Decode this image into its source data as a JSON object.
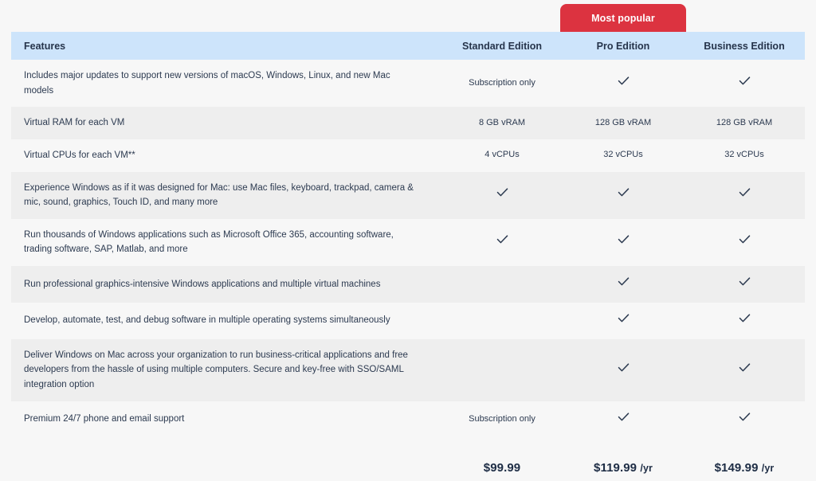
{
  "badge": {
    "label": "Most popular",
    "color": "#dc3340",
    "column": "Pro Edition"
  },
  "header": {
    "feature_column_label": "Features",
    "plans": [
      {
        "name": "Standard Edition"
      },
      {
        "name": "Pro Edition"
      },
      {
        "name": "Business Edition"
      }
    ],
    "background_color": "#cde4fb"
  },
  "rows": [
    {
      "feature": "Includes major updates to support new versions of macOS, Windows, Linux, and new Mac models",
      "standard": "Subscription only",
      "pro": "check",
      "business": "check"
    },
    {
      "feature": "Virtual RAM for each VM",
      "standard": "8 GB vRAM",
      "pro": "128 GB vRAM",
      "business": "128 GB vRAM"
    },
    {
      "feature": "Virtual CPUs for each VM**",
      "standard": "4 vCPUs",
      "pro": "32 vCPUs",
      "business": "32 vCPUs"
    },
    {
      "feature": "Experience Windows as if it was designed for Mac: use Mac files, keyboard, trackpad, camera & mic, sound, graphics, Touch ID, and many more",
      "standard": "check",
      "pro": "check",
      "business": "check"
    },
    {
      "feature": "Run thousands of Windows applications such as Microsoft Office 365, accounting software, trading software, SAP, Matlab, and more",
      "standard": "check",
      "pro": "check",
      "business": "check"
    },
    {
      "feature": "Run professional graphics-intensive Windows applications and multiple virtual machines",
      "standard": "",
      "pro": "check",
      "business": "check"
    },
    {
      "feature": "Develop, automate, test, and debug software in multiple operating systems simultaneously",
      "standard": "",
      "pro": "check",
      "business": "check"
    },
    {
      "feature": "Deliver Windows on Mac across your organization to run business-critical applications and free developers from the hassle of using multiple computers. Secure and key-free with SSO/SAML integration option",
      "standard": "",
      "pro": "check",
      "business": "check"
    },
    {
      "feature": "Premium 24/7 phone and email support",
      "standard": "Subscription only",
      "pro": "check",
      "business": "check"
    }
  ],
  "pricing": {
    "standard_amount": "$99.99",
    "standard_period": "",
    "pro_amount": "$119.99",
    "pro_period": "/yr",
    "business_amount": "$149.99",
    "business_period": "/yr"
  }
}
